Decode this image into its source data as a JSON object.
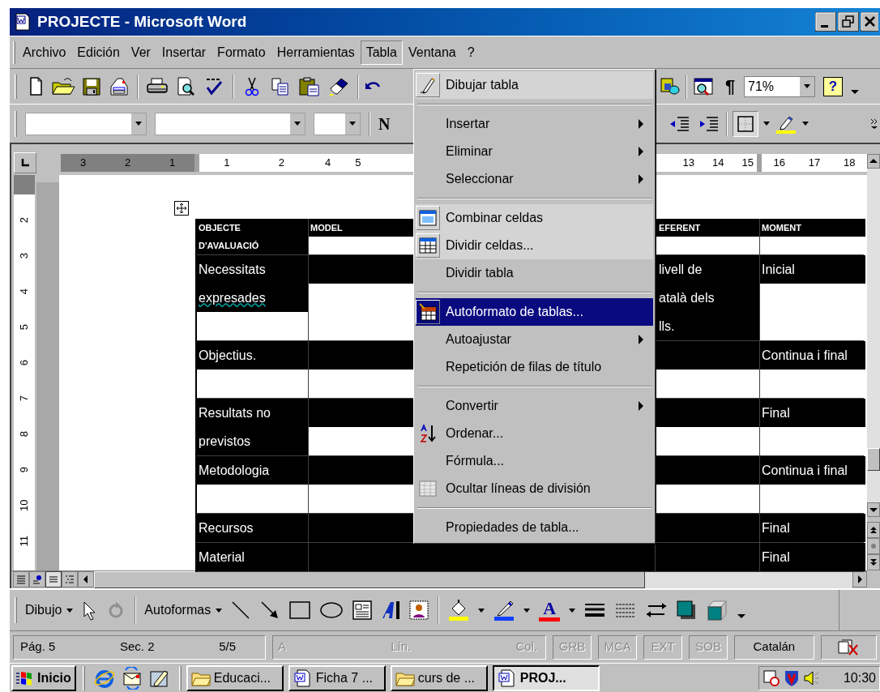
{
  "window": {
    "title": "PROJECTE - Microsoft Word"
  },
  "menu_bar": [
    {
      "label": "Archivo",
      "selected": false
    },
    {
      "label": "Edición",
      "selected": false
    },
    {
      "label": "Ver",
      "selected": false
    },
    {
      "label": "Insertar",
      "selected": false
    },
    {
      "label": "Formato",
      "selected": false
    },
    {
      "label": "Herramientas",
      "selected": false
    },
    {
      "label": "Tabla",
      "selected": true
    },
    {
      "label": "Ventana",
      "selected": false
    },
    {
      "label": "?",
      "selected": false
    }
  ],
  "standard_toolbar": {
    "pilcrow": "¶",
    "zoom": "71%",
    "help": "?"
  },
  "formatting_toolbar": {
    "bold": "N"
  },
  "ruler": {
    "segments": [
      [
        "3",
        "2",
        "1"
      ],
      [
        "1",
        "2"
      ],
      [
        "4",
        "5"
      ],
      [
        "13",
        "14",
        "15"
      ],
      [
        "16",
        "17",
        "18"
      ]
    ]
  },
  "vertical_ruler": [
    "2",
    "3",
    "4",
    "5",
    "6",
    "7",
    "8",
    "9",
    "10",
    "11"
  ],
  "table": {
    "rows": [
      {
        "kind": "header",
        "cells": [
          [
            {
              "kind": "highlight",
              "text": "OBJECTE"
            },
            {
              "kind": "highlight",
              "text": "D'AVALUACIÓ"
            }
          ],
          [
            {
              "kind": "highlight",
              "text": "MODEL"
            },
            {
              "kind": "blank"
            }
          ],
          [
            {
              "kind": "highlight",
              "text": "EFERENT"
            },
            {
              "kind": "blank"
            }
          ],
          [
            {
              "kind": "highlight",
              "text": "MOMENT"
            },
            {
              "kind": "blank"
            }
          ]
        ]
      },
      {
        "kind": "body",
        "cells": [
          [
            {
              "kind": "highlight",
              "text": "Necessitats"
            },
            {
              "kind": "highlight",
              "text": "expresades",
              "spelling_error": true
            },
            {
              "kind": "blank"
            }
          ],
          [
            {
              "kind": "highlight"
            },
            {
              "kind": "blank"
            },
            {
              "kind": "blank"
            }
          ],
          [
            {
              "kind": "highlight",
              "text": "livell de"
            },
            {
              "kind": "highlight",
              "text": "atalà dels"
            },
            {
              "kind": "highlight",
              "text": "lls."
            }
          ],
          [
            {
              "kind": "highlight",
              "text": "Inicial"
            },
            {
              "kind": "blank"
            },
            {
              "kind": "blank"
            }
          ]
        ]
      },
      {
        "kind": "body",
        "cells": [
          [
            {
              "kind": "highlight",
              "text": "Objectius."
            },
            {
              "kind": "blank"
            }
          ],
          [
            {
              "kind": "highlight"
            },
            {
              "kind": "blank"
            }
          ],
          [
            {
              "kind": "highlight"
            },
            {
              "kind": "blank"
            }
          ],
          [
            {
              "kind": "highlight",
              "text": "Continua i final"
            },
            {
              "kind": "blank"
            }
          ]
        ]
      },
      {
        "kind": "body",
        "cells": [
          [
            {
              "kind": "highlight",
              "text": "Resultats no"
            },
            {
              "kind": "highlight",
              "text": "previstos"
            }
          ],
          [
            {
              "kind": "highlight"
            },
            {
              "kind": "blank"
            }
          ],
          [
            {
              "kind": "highlight"
            },
            {
              "kind": "blank"
            }
          ],
          [
            {
              "kind": "highlight",
              "text": "Final"
            },
            {
              "kind": "blank"
            }
          ]
        ]
      },
      {
        "kind": "body",
        "cells": [
          [
            {
              "kind": "highlight",
              "text": "Metodologia"
            },
            {
              "kind": "blank"
            }
          ],
          [
            {
              "kind": "highlight"
            },
            {
              "kind": "blank"
            }
          ],
          [
            {
              "kind": "highlight"
            },
            {
              "kind": "blank"
            }
          ],
          [
            {
              "kind": "highlight",
              "text": "Continua i final"
            },
            {
              "kind": "blank"
            }
          ]
        ]
      },
      {
        "kind": "body",
        "cells": [
          [
            {
              "kind": "highlight",
              "text": "Recursos"
            }
          ],
          [
            {
              "kind": "highlight"
            }
          ],
          [
            {
              "kind": "highlight"
            }
          ],
          [
            {
              "kind": "highlight",
              "text": "Final"
            }
          ]
        ]
      },
      {
        "kind": "body",
        "cells": [
          [
            {
              "kind": "highlight",
              "text": "Material"
            }
          ],
          [
            {
              "kind": "highlight"
            }
          ],
          [
            {
              "kind": "highlight"
            }
          ],
          [
            {
              "kind": "highlight",
              "text": "Final"
            }
          ]
        ]
      }
    ]
  },
  "table_menu": {
    "items": [
      {
        "kind": "item",
        "label": "Dibujar tabla",
        "shaded": true,
        "selected": false,
        "submenu": false
      },
      {
        "kind": "separator"
      },
      {
        "kind": "item",
        "label": "Insertar",
        "shaded": false,
        "selected": false,
        "submenu": true
      },
      {
        "kind": "item",
        "label": "Eliminar",
        "shaded": false,
        "selected": false,
        "submenu": true
      },
      {
        "kind": "item",
        "label": "Seleccionar",
        "shaded": false,
        "selected": false,
        "submenu": true
      },
      {
        "kind": "separator"
      },
      {
        "kind": "item",
        "label": "Combinar celdas",
        "shaded": true,
        "selected": false,
        "submenu": false
      },
      {
        "kind": "item",
        "label": "Dividir celdas...",
        "shaded": true,
        "selected": false,
        "submenu": false
      },
      {
        "kind": "item",
        "label": "Dividir tabla",
        "shaded": false,
        "selected": false,
        "submenu": false
      },
      {
        "kind": "separator"
      },
      {
        "kind": "item",
        "label": "Autoformato de tablas...",
        "shaded": false,
        "selected": true,
        "submenu": false
      },
      {
        "kind": "item",
        "label": "Autoajustar",
        "shaded": false,
        "selected": false,
        "submenu": true
      },
      {
        "kind": "item",
        "label": "Repetición de filas de título",
        "shaded": false,
        "selected": false,
        "submenu": false
      },
      {
        "kind": "separator"
      },
      {
        "kind": "item",
        "label": "Convertir",
        "shaded": false,
        "selected": false,
        "submenu": true
      },
      {
        "kind": "item",
        "label": "Ordenar...",
        "shaded": false,
        "selected": false,
        "submenu": false
      },
      {
        "kind": "item",
        "label": "Fórmula...",
        "shaded": false,
        "selected": false,
        "submenu": false
      },
      {
        "kind": "item",
        "label": "Ocultar líneas de división",
        "shaded": false,
        "selected": false,
        "submenu": false
      },
      {
        "kind": "separator"
      },
      {
        "kind": "item",
        "label": "Propiedades de tabla...",
        "shaded": false,
        "selected": false,
        "submenu": false
      }
    ]
  },
  "drawing_toolbar": {
    "draw": "Dibujo",
    "autoshapes": "Autoformas",
    "font_color": "A"
  },
  "status_bar": {
    "page_info": [
      "Pág. 5",
      "Sec. 2",
      "5/5"
    ],
    "cursor_info": [
      {
        "text": "A",
        "disabled": true
      },
      {
        "text": "Lín.",
        "disabled": true
      },
      {
        "text": "Col.",
        "disabled": true
      }
    ],
    "modes": [
      {
        "text": "GRB",
        "disabled": true
      },
      {
        "text": "MCA",
        "disabled": true
      },
      {
        "text": "EXT",
        "disabled": true
      },
      {
        "text": "SOB",
        "disabled": true
      }
    ],
    "language": "Catalán"
  },
  "taskbar": {
    "start": "Inicio",
    "tasks": [
      {
        "label": "Educaci...",
        "kind": "folder",
        "selected": false
      },
      {
        "label": "Ficha 7 ...",
        "kind": "document",
        "selected": false
      },
      {
        "label": "curs de ...",
        "kind": "folder",
        "selected": false
      },
      {
        "label": "PROJ...",
        "kind": "document",
        "selected": true
      }
    ],
    "clock": "10:30"
  }
}
